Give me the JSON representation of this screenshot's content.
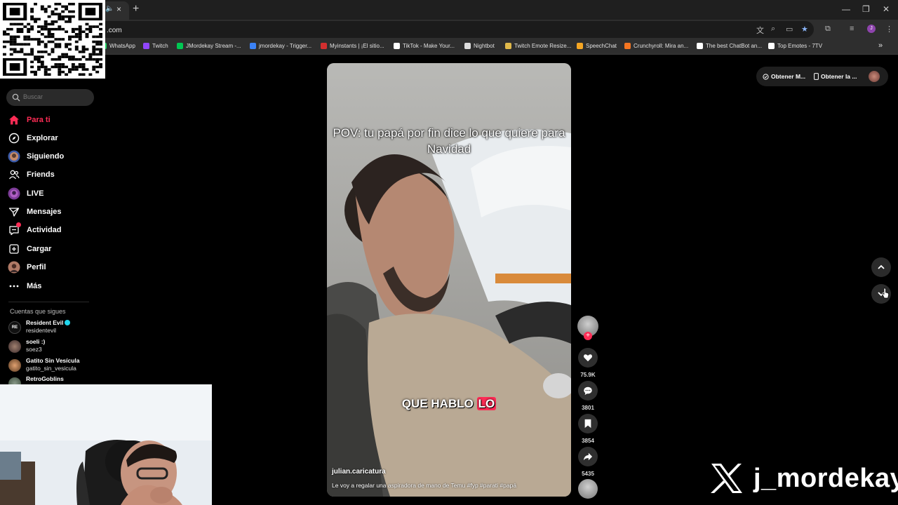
{
  "browser": {
    "url": ".com",
    "new_tab": "+",
    "tab_close": "×",
    "bookmarks": [
      {
        "label": "WhatsApp",
        "color": "#25d366"
      },
      {
        "label": "Twitch",
        "color": "#9146ff"
      },
      {
        "label": "JMordekay Stream -...",
        "color": "#00c853"
      },
      {
        "label": "jmordekay - Trigger...",
        "color": "#3b82f6"
      },
      {
        "label": "Myinstants | ¡El sitio...",
        "color": "#d32f2f"
      },
      {
        "label": "TikTok - Make Your...",
        "color": "#ffffff"
      },
      {
        "label": "Nightbot",
        "color": "#dddddd"
      },
      {
        "label": "Twitch Emote Resize...",
        "color": "#e0b84a"
      },
      {
        "label": "SpeechChat",
        "color": "#f5a623"
      },
      {
        "label": "Crunchyroll: Mira an...",
        "color": "#f47521"
      },
      {
        "label": "The best ChatBot an...",
        "color": "#ffffff"
      },
      {
        "label": "Top Emotes - 7TV",
        "color": "#ffffff"
      }
    ],
    "more_bookmarks": "»"
  },
  "sidebar": {
    "search_placeholder": "Buscar",
    "items": [
      {
        "label": "Para ti",
        "icon": "home-icon"
      },
      {
        "label": "Explorar",
        "icon": "compass-icon"
      },
      {
        "label": "Siguiendo",
        "icon": "following-icon"
      },
      {
        "label": "Friends",
        "icon": "friends-icon"
      },
      {
        "label": "LIVE",
        "icon": "live-icon"
      },
      {
        "label": "Mensajes",
        "icon": "send-icon"
      },
      {
        "label": "Actividad",
        "icon": "activity-icon"
      },
      {
        "label": "Cargar",
        "icon": "upload-icon"
      },
      {
        "label": "Perfil",
        "icon": "profile-icon"
      },
      {
        "label": "Más",
        "icon": "more-icon"
      }
    ],
    "following_title": "Cuentas que sigues",
    "following": [
      {
        "name": "Resident Evil",
        "handle": "residentevil"
      },
      {
        "name": "soeli :)",
        "handle": "soez3"
      },
      {
        "name": "Gatito Sin Vesícula",
        "handle": "gatito_sin_vesicula"
      },
      {
        "name": "RetroGoblins",
        "handle": ""
      }
    ]
  },
  "video": {
    "caption_top": "POV: tu papá por fin dice lo que quiere para Navidad",
    "subtitle_a": "QUE HABLO",
    "subtitle_b": "LO",
    "author": "julian.caricatura",
    "description": "Le voy a regalar una aspiradora de mano de Temu #fyp #parati #papá"
  },
  "actions": {
    "likes": "75.9K",
    "comments": "3801",
    "saves": "3854",
    "shares": "5435",
    "follow_plus": "+"
  },
  "top_right": {
    "get_app_1": "Obtener M...",
    "get_app_2": "Obtener la ..."
  },
  "watermark": {
    "handle": "j_mordekay"
  },
  "colors": {
    "accent": "#fe2c55",
    "background": "#000000",
    "verified": "#20d5ec"
  }
}
